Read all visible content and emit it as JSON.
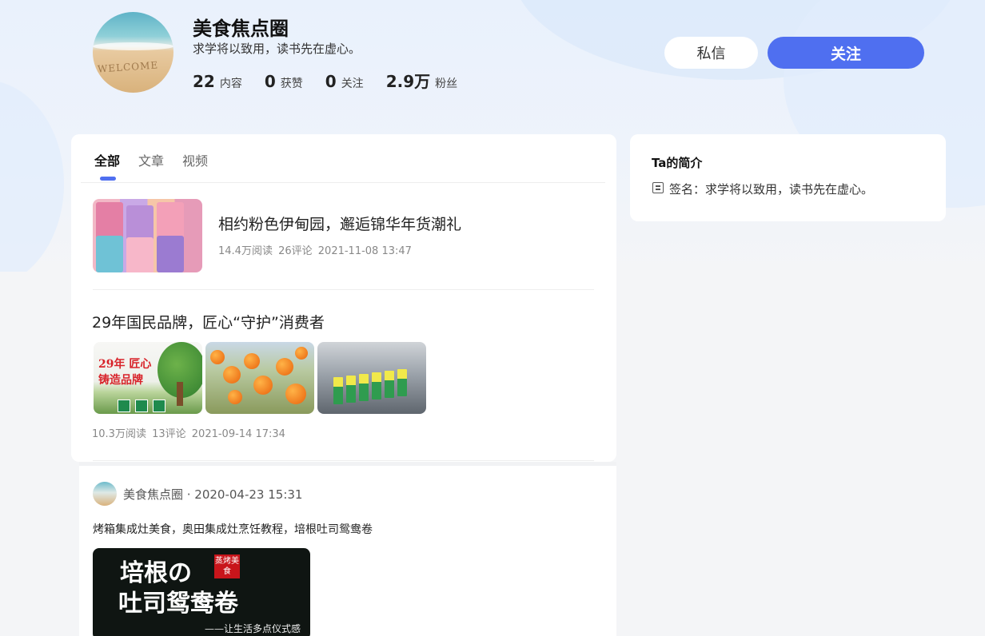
{
  "profile": {
    "name": "美食焦点圈",
    "bio": "求学将以致用，读书先在虚心。",
    "avatar_text": "WELCOME",
    "stats": [
      {
        "value": "22",
        "label": "内容"
      },
      {
        "value": "0",
        "label": "获赞"
      },
      {
        "value": "0",
        "label": "关注"
      },
      {
        "value": "2.9万",
        "label": "粉丝"
      }
    ],
    "message_label": "私信",
    "follow_label": "关注"
  },
  "tabs": [
    {
      "label": "全部",
      "active": true
    },
    {
      "label": "文章",
      "active": false
    },
    {
      "label": "视频",
      "active": false
    }
  ],
  "articles": [
    {
      "title": "相约粉色伊甸园，邂逅锦华年货潮礼",
      "reads": "14.4万阅读",
      "comments": "26评论",
      "date": "2021-11-08 13:47"
    },
    {
      "title": "29年国民品牌，匠心“守护”消费者",
      "image_text": "29年 匠心铸造品牌",
      "reads": "10.3万阅读",
      "comments": "13评论",
      "date": "2021-09-14 17:34"
    }
  ],
  "post": {
    "author_line": "美食焦点圈 · 2020-04-23 15:31",
    "text": "烤箱集成灶美食，奥田集成灶烹饪教程，培根吐司鸳鸯卷",
    "video_line1": "培根の",
    "video_line2": "吐司鸳鸯卷",
    "video_seal": "蒸烤美食",
    "video_caption": "——让生活多点仪式感"
  },
  "sidebar": {
    "title": "Ta的简介",
    "sign": "签名：求学将以致用，读书先在虚心。"
  },
  "colors": {
    "accent": "#4f6ff0",
    "page_bg": "#f4f5f7"
  }
}
